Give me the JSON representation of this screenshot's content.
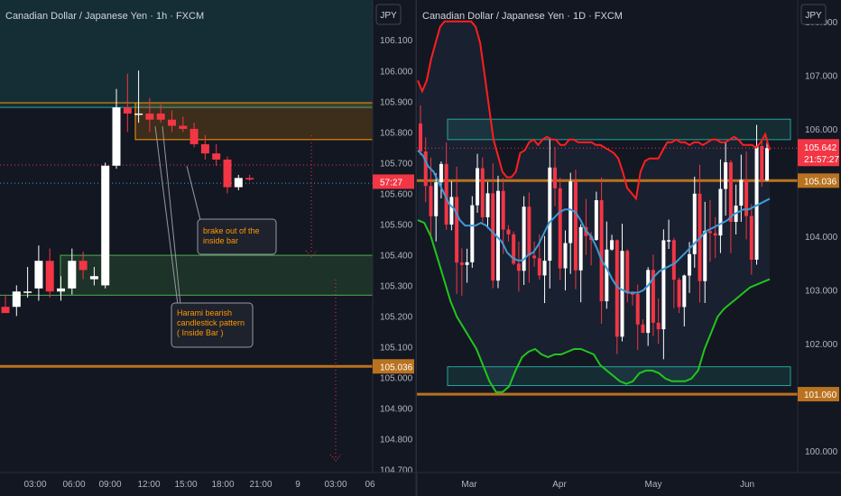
{
  "colors": {
    "background": "#131722",
    "bull_candle": "#ffffff",
    "bear_candle": "#f23645",
    "orange_zone": "#ff9800",
    "green_zone": "#4caf50",
    "support_line": "#b9721f",
    "upper_band": "#ff1f1f",
    "lower_band": "#22c51c",
    "middle_band": "#3d9bd4",
    "teal_zone": "#26a69a",
    "annotation_text": "#ff9800"
  },
  "chart_data": [
    {
      "type": "candlestick",
      "title": "Canadian Dollar / Japanese Yen · 1h · FXCM",
      "currency_button": "JPY",
      "y_ticks": [
        "106.100",
        "106.000",
        "105.900",
        "105.800",
        "105.700",
        "105.600",
        "105.500",
        "105.400",
        "105.300",
        "105.200",
        "105.100",
        "105.000",
        "104.900",
        "104.800",
        "104.700"
      ],
      "x_ticks": [
        "03:00",
        "06:00",
        "09:00",
        "12:00",
        "15:00",
        "18:00",
        "21:00",
        "9",
        "03:00",
        "06"
      ],
      "ylim": [
        104.69,
        106.23
      ],
      "price_labels": [
        {
          "text": "57:27",
          "value": 105.638,
          "color": "#f23645"
        },
        {
          "text": "105.036",
          "value": 105.036,
          "color": "#b9721f"
        }
      ],
      "zones": [
        {
          "name": "upper-green-zone",
          "from": 105.88,
          "to": 106.23,
          "color": "#26a69a"
        },
        {
          "name": "orange-zone",
          "from": 105.775,
          "to": 105.895,
          "color": "#ff9800"
        },
        {
          "name": "green-zone",
          "from": 105.268,
          "to": 105.398,
          "color": "#4caf50"
        }
      ],
      "support_level": 105.036,
      "reference_lines": [
        105.692,
        105.633
      ],
      "candles": [
        {
          "o": 105.23,
          "h": 105.27,
          "l": 105.21,
          "c": 105.21
        },
        {
          "o": 105.23,
          "h": 105.3,
          "l": 105.2,
          "c": 105.28
        },
        {
          "o": 105.28,
          "h": 105.36,
          "l": 105.26,
          "c": 105.28
        },
        {
          "o": 105.29,
          "h": 105.43,
          "l": 105.25,
          "c": 105.38
        },
        {
          "o": 105.38,
          "h": 105.42,
          "l": 105.26,
          "c": 105.28
        },
        {
          "o": 105.28,
          "h": 105.33,
          "l": 105.25,
          "c": 105.29
        },
        {
          "o": 105.29,
          "h": 105.42,
          "l": 105.27,
          "c": 105.38
        },
        {
          "o": 105.38,
          "h": 105.41,
          "l": 105.32,
          "c": 105.35
        },
        {
          "o": 105.32,
          "h": 105.36,
          "l": 105.3,
          "c": 105.33
        },
        {
          "o": 105.3,
          "h": 105.7,
          "l": 105.29,
          "c": 105.69
        },
        {
          "o": 105.69,
          "h": 105.94,
          "l": 105.68,
          "c": 105.88
        },
        {
          "o": 105.88,
          "h": 105.99,
          "l": 105.8,
          "c": 105.86
        },
        {
          "o": 105.86,
          "h": 106.0,
          "l": 105.83,
          "c": 105.86
        },
        {
          "o": 105.86,
          "h": 105.91,
          "l": 105.8,
          "c": 105.84
        },
        {
          "o": 105.86,
          "h": 105.89,
          "l": 105.83,
          "c": 105.84
        },
        {
          "o": 105.84,
          "h": 105.87,
          "l": 105.8,
          "c": 105.82
        },
        {
          "o": 105.82,
          "h": 105.85,
          "l": 105.8,
          "c": 105.81
        },
        {
          "o": 105.81,
          "h": 105.83,
          "l": 105.75,
          "c": 105.76
        },
        {
          "o": 105.76,
          "h": 105.79,
          "l": 105.71,
          "c": 105.73
        },
        {
          "o": 105.73,
          "h": 105.76,
          "l": 105.69,
          "c": 105.71
        },
        {
          "o": 105.71,
          "h": 105.72,
          "l": 105.6,
          "c": 105.62
        },
        {
          "o": 105.62,
          "h": 105.66,
          "l": 105.61,
          "c": 105.65
        },
        {
          "o": 105.65,
          "h": 105.66,
          "l": 105.64,
          "c": 105.645
        }
      ],
      "annotations": [
        {
          "name": "breakout-note",
          "lines": [
            "brake out of the",
            "inside bar"
          ]
        },
        {
          "name": "harami-note",
          "lines": [
            "Harami bearish",
            "candlestick pattern",
            "( Inside Bar )"
          ]
        }
      ]
    },
    {
      "type": "candlestick",
      "title": "Canadian Dollar / Japanese Yen · 1D · FXCM",
      "currency_button": "JPY",
      "y_ticks": [
        "108.000",
        "107.000",
        "106.000",
        "105.000",
        "104.000",
        "103.000",
        "102.000",
        "101.000",
        "100.000"
      ],
      "x_ticks": [
        "Mar",
        "Apr",
        "May",
        "Jun"
      ],
      "ylim": [
        99.6,
        108.4
      ],
      "price_labels": [
        {
          "text": "105.642",
          "value": 105.642,
          "color": "#f23645",
          "sub": "21:57:27"
        },
        {
          "text": "105.036",
          "value": 105.036,
          "color": "#b9721f"
        },
        {
          "text": "101.060",
          "value": 101.06,
          "color": "#b9721f"
        }
      ],
      "zones": [
        {
          "name": "resistance-zone",
          "from": 105.8,
          "to": 106.18,
          "color": "#26a69a"
        },
        {
          "name": "support-zone",
          "from": 101.22,
          "to": 101.57,
          "color": "#26a69a"
        }
      ],
      "levels": [
        105.036,
        101.06
      ],
      "current_price": 105.642,
      "upper_band": [
        106.9,
        106.7,
        106.9,
        107.3,
        107.6,
        107.9,
        108.0,
        108.0,
        108.0,
        108.0,
        108.0,
        108.0,
        108.0,
        107.9,
        107.6,
        107.0,
        106.4,
        105.8,
        105.5,
        105.2,
        105.1,
        105.1,
        105.2,
        105.55,
        105.6,
        105.75,
        105.8,
        105.7,
        105.8,
        105.85,
        105.8,
        105.8,
        105.7,
        105.7,
        105.8,
        105.8,
        105.75,
        105.75,
        105.75,
        105.75,
        105.7,
        105.7,
        105.65,
        105.6,
        105.55,
        105.45,
        105.2,
        104.9,
        104.8,
        104.7,
        105.2,
        105.4,
        105.45,
        105.45,
        105.45,
        105.6,
        105.75,
        105.75,
        105.8,
        105.75,
        105.75,
        105.7,
        105.75,
        105.75,
        105.7,
        105.75,
        105.8,
        105.8,
        105.75,
        105.75,
        105.8,
        105.85,
        105.8,
        105.7,
        105.7,
        105.7,
        105.65,
        105.75,
        105.9,
        105.6
      ],
      "middle_band": [
        105.6,
        105.5,
        105.3,
        105.2,
        105.0,
        104.8,
        104.6,
        104.5,
        104.3,
        104.2,
        104.2,
        104.2,
        104.25,
        104.2,
        104.1,
        104.0,
        103.9,
        103.7,
        103.6,
        103.55,
        103.55,
        103.65,
        103.7,
        103.85,
        104.05,
        104.25,
        104.35,
        104.45,
        104.5,
        104.5,
        104.45,
        104.3,
        104.1,
        104.0,
        103.8,
        103.55,
        103.4,
        103.2,
        103.05,
        103.0,
        102.95,
        102.95,
        102.95,
        103.0,
        103.1,
        103.25,
        103.35,
        103.4,
        103.45,
        103.5,
        103.6,
        103.7,
        103.8,
        103.9,
        104.0,
        104.1,
        104.15,
        104.2,
        104.25,
        104.3,
        104.4,
        104.45,
        104.5,
        104.5,
        104.55,
        104.6,
        104.65,
        104.7
      ],
      "lower_band": [
        104.3,
        104.25,
        104.0,
        103.6,
        103.2,
        102.8,
        102.5,
        102.3,
        102.1,
        101.9,
        101.6,
        101.3,
        101.1,
        101.1,
        101.2,
        101.5,
        101.75,
        101.85,
        101.9,
        101.8,
        101.75,
        101.8,
        101.8,
        101.85,
        101.9,
        101.9,
        101.85,
        101.8,
        101.6,
        101.5,
        101.4,
        101.3,
        101.25,
        101.3,
        101.45,
        101.5,
        101.5,
        101.45,
        101.35,
        101.3,
        101.3,
        101.3,
        101.35,
        101.5,
        101.9,
        102.2,
        102.5,
        102.65,
        102.75,
        102.85,
        102.95,
        103.05,
        103.1,
        103.15,
        103.2
      ]
    }
  ]
}
